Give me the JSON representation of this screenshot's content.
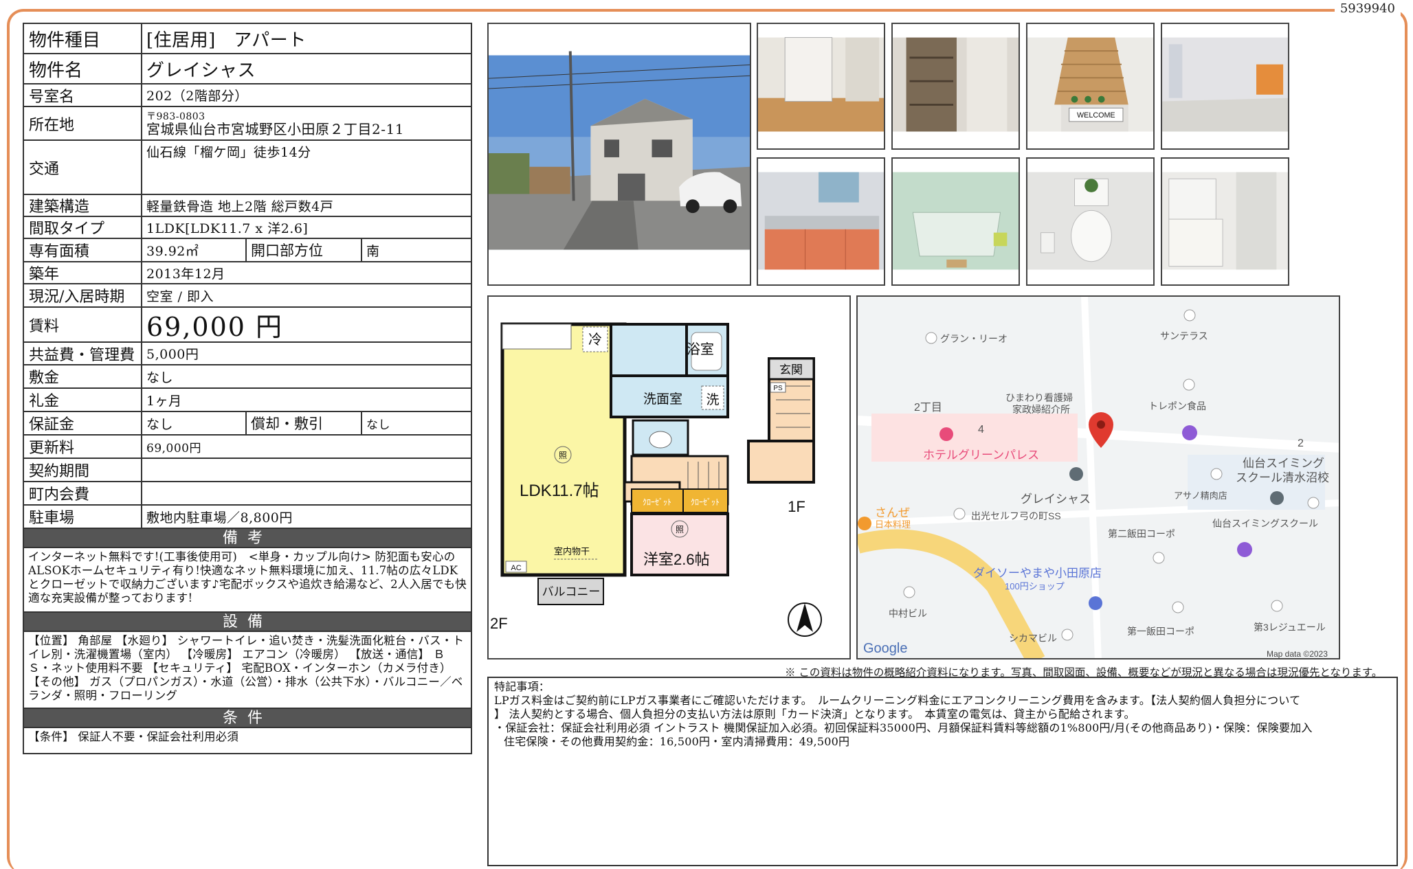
{
  "doc_id": "5939940",
  "spec": {
    "type": {
      "label": "物件種目",
      "value": "[住居用]　アパート"
    },
    "name": {
      "label": "物件名",
      "value": "グレイシャス"
    },
    "room": {
      "label": "号室名",
      "value": "202（2階部分）"
    },
    "address": {
      "label": "所在地",
      "zip": "〒983-0803",
      "value": "宮城県仙台市宮城野区小田原２丁目2-11"
    },
    "access": {
      "label": "交通",
      "value": "仙石線「榴ケ岡」徒歩14分"
    },
    "structure": {
      "label": "建築構造",
      "value": "軽量鉄骨造 地上2階 総戸数4戸"
    },
    "layout": {
      "label": "間取タイプ",
      "value": "1LDK[LDK11.7 x 洋2.6]"
    },
    "area": {
      "label": "専有面積",
      "value": "39.92㎡",
      "sub_label": "開口部方位",
      "sub_value": "南"
    },
    "built": {
      "label": "築年",
      "value": "2013年12月"
    },
    "status": {
      "label": "現況/入居時期",
      "value": "空室 / 即入"
    },
    "rent": {
      "label": "賃料",
      "value": "69,000 円"
    },
    "fee": {
      "label": "共益費・管理費",
      "value": "5,000円"
    },
    "deposit": {
      "label": "敷金",
      "value": "なし"
    },
    "key_money": {
      "label": "礼金",
      "value": "1ヶ月"
    },
    "guarantee": {
      "label": "保証金",
      "value": "なし",
      "sub_label": "償却・敷引",
      "sub_value": "なし"
    },
    "renewal": {
      "label": "更新料",
      "value": "69,000円"
    },
    "contract": {
      "label": "契約期間",
      "value": ""
    },
    "town_fee": {
      "label": "町内会費",
      "value": ""
    },
    "parking": {
      "label": "駐車場",
      "value": "敷地内駐車場／8,800円"
    }
  },
  "remarks_section": {
    "title": "備考",
    "text": "インターネット無料です!(工事後使用可)　<単身・カップル向け> 防犯面も安心のALSOKホームセキュリティ有り!快適なネット無料環境に加え、11.7帖の広々LDKとクローゼットで収納力ございます♪宅配ボックスや追炊き給湯など、2人入居でも快適な充実設備が整っております!"
  },
  "equipment_section": {
    "title": "設備",
    "text": "【位置】 角部屋 【水廻り】 シャワートイレ・追い焚き・洗髪洗面化粧台・バス・トイレ別・洗濯機置場（室内） 【冷暖房】 エアコン（冷暖房） 【放送・通信】 ＢＳ・ネット使用料不要 【セキュリティ】 宅配BOX・インターホン（カメラ付き） 【その他】 ガス（プロパンガス）・水道（公営）・排水（公共下水）・バルコニー／ベランダ・照明・フローリング"
  },
  "conditions_section": {
    "title": "条件",
    "text": "【条件】 保証人不要・保証会社利用必須"
  },
  "floorplan": {
    "ldk": "LDK11.7帖",
    "western": "洋室2.6帖",
    "bath": "浴室",
    "washroom": "洗面室",
    "wash": "洗",
    "fridge": "冷",
    "closet": "クローゼット",
    "closet_short": "ｸﾛｰｾﾞｯﾄ",
    "entrance": "玄関",
    "balcony": "バルコニー",
    "dry": "室内物干",
    "ac": "AC",
    "ps": "PS",
    "light": "照",
    "floor2": "2F",
    "floor1": "1F"
  },
  "map": {
    "labels": {
      "gran": "グラン・リーオ",
      "suntera": "サンテラス",
      "himawari1": "ひまわり看護婦",
      "himawari2": "家政婦紹介所",
      "chome": "2丁目",
      "num4": "4",
      "num2": "2",
      "trepon": "トレポン食品",
      "hotel": "ホテルグリーンパレス",
      "sendai_swim1": "仙台スイミング",
      "sendai_swim2": "スクール清水沼校",
      "gracious": "グレイシャス",
      "asano": "アサノ精肉店",
      "sanze1": "さんぜ",
      "sanze2": "日本料理",
      "idemitsu": "出光セルフ弓の町SS",
      "daini": "第二飯田コーポ",
      "swim_school": "仙台スイミングスクール",
      "daiso1": "ダイソーやまや小田原店",
      "daiso2": "100円ショップ",
      "nakamura": "中村ビル",
      "shikama": "シカマビル",
      "daiichi": "第一飯田コーポ",
      "residence": "第3レジュエール",
      "google": "Google",
      "mapdata": "Map data ©2023"
    }
  },
  "disclaimer": "※ この資料は物件の概略紹介資料になります。写真、間取図面、設備、概要などが現況と異なる場合は現況優先となります。",
  "special": {
    "title": "特記事項：",
    "lines": [
      "LPガス料金はご契約前にLPガス事業者にご確認いただけます。　ルームクリーニング料金にエアコンクリーニング費用を含みます。【法人契約個人負担分について",
      "】 法人契約とする場合、個人負担分の支払い方法は原則「カード決済」となります。　本賃室の電気は、貸主から配給されます。",
      "・保証会社：保証会社利用必須 イントラスト 機関保証加入必須。初回保証料35000円、月額保証料賃料等総額の1%800円/月(その他商品あり)・保険：保険要加入",
      "住宅保険・その他費用契約金：16,500円・室内清掃費用：49,500円"
    ]
  },
  "welcome": "WELCOME"
}
